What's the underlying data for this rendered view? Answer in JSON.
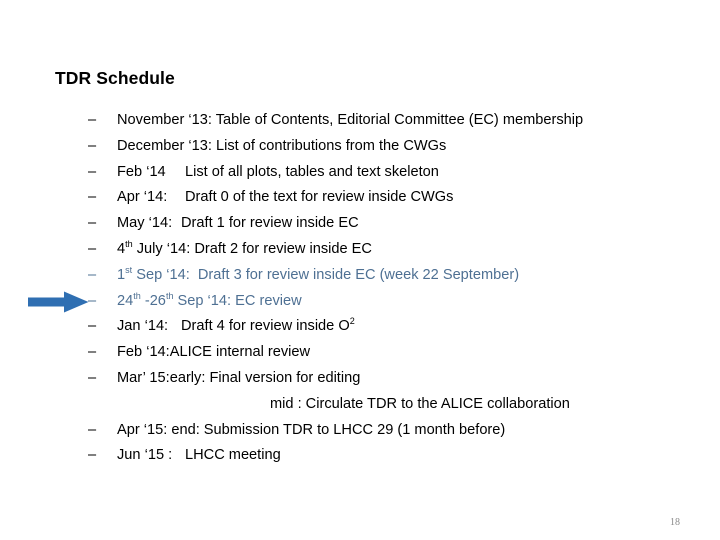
{
  "slide": {
    "title": "TDR Schedule",
    "page_number": "18",
    "bullet_glyph": "–",
    "accent_blue": "#4e7093",
    "arrow_color": "#2f6fb2",
    "arrow_name": "blue-right-arrow"
  },
  "items": [
    {
      "id": "nov-13",
      "date": "November ‘13: Table of Contents, Editorial Committee (EC) membership",
      "detail": "",
      "color": "black",
      "tab": "none"
    },
    {
      "id": "dec-13",
      "date": "December ‘13: List of contributions from the CWGs",
      "detail": "",
      "color": "black",
      "tab": "none"
    },
    {
      "id": "feb-14",
      "date": "Feb ‘14",
      "detail": "List of all plots, tables and text skeleton",
      "color": "black",
      "tab": "tab-1"
    },
    {
      "id": "apr-14",
      "date": "Apr ‘14:",
      "detail": "Draft 0 of the text for review inside CWGs",
      "color": "black",
      "tab": "tab-1"
    },
    {
      "id": "may-14",
      "date": "May ‘14:",
      "detail": "Draft 1 for review inside EC",
      "color": "black",
      "tab": "tab-2"
    },
    {
      "id": "july-14",
      "date": "4th July ‘14:",
      "detail": "Draft 2 for review inside EC",
      "color": "black",
      "tab": "none"
    },
    {
      "id": "sep-1-14",
      "date": "1st Sep ‘14:",
      "detail": "Draft 3 for review inside EC (week 22 September)",
      "color": "blue",
      "tab": "none"
    },
    {
      "id": "sep-24-26-14",
      "date": "24th -26th Sep ‘14: EC review",
      "detail": "",
      "color": "blue",
      "tab": "none"
    },
    {
      "id": "jan-14",
      "date": "Jan ‘14:",
      "detail": "Draft 4 for review inside O2",
      "color": "black",
      "tab": "tab-2"
    },
    {
      "id": "feb-14-alice",
      "date": "Feb ‘14:",
      "detail": "ALICE internal review",
      "color": "black",
      "tab": "none"
    },
    {
      "id": "mar-15",
      "date": "Mar’ 15:",
      "detail": "early: Final version for editing",
      "color": "black",
      "tab": "none"
    },
    {
      "id": "apr-15",
      "date": "Apr ‘15: end: Submission TDR to LHCC 29 (1 month before)",
      "detail": "",
      "color": "black",
      "tab": "none"
    },
    {
      "id": "jun-15",
      "date": "Jun ‘15 :",
      "detail": "LHCC meeting",
      "color": "black",
      "tab": "tab-1"
    }
  ],
  "subline": {
    "text": "mid : Circulate TDR to the ALICE collaboration"
  }
}
